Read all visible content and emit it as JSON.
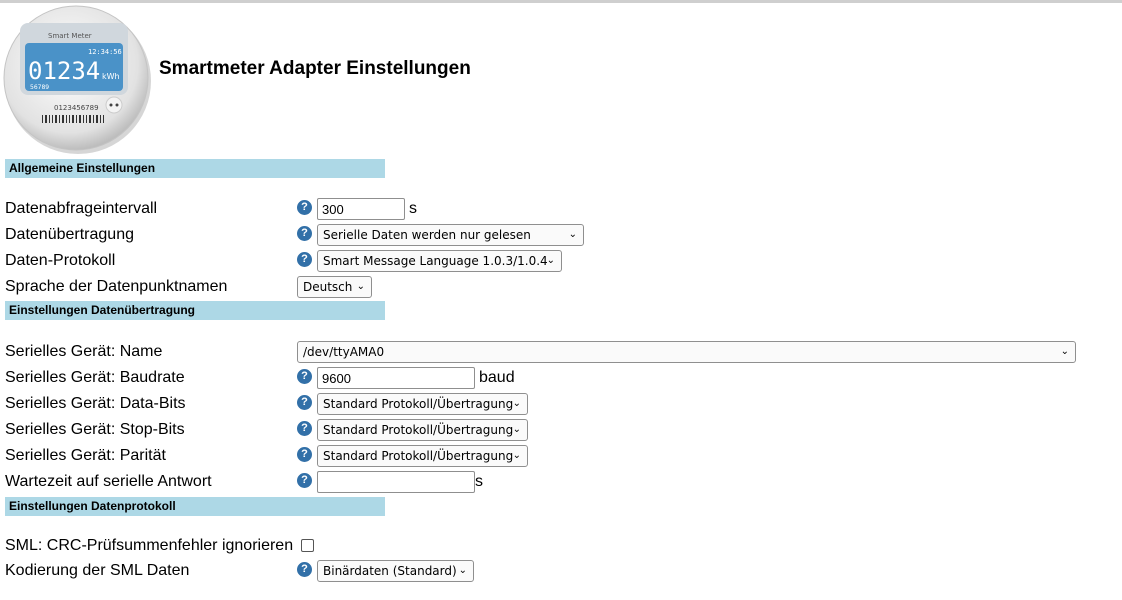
{
  "page": {
    "title": "Smartmeter Adapter Einstellungen"
  },
  "logo": {
    "brand": "Smart Meter",
    "time": "12:34:56",
    "reading": "01234",
    "unit": "kWh",
    "sub": "56789",
    "serial": "0123456789"
  },
  "sections": {
    "general": "Allgemeine Einstellungen",
    "transfer": "Einstellungen Datenübertragung",
    "protocol": "Einstellungen Datenprotokoll"
  },
  "general": {
    "interval": {
      "label": "Datenabfrageintervall",
      "value": "300",
      "unit": "s"
    },
    "transfer_mode": {
      "label": "Datenübertragung",
      "value": "Serielle Daten werden nur gelesen"
    },
    "protocol": {
      "label": "Daten-Protokoll",
      "value": "Smart Message Language 1.0.3/1.0.4"
    },
    "language": {
      "label": "Sprache der Datenpunktnamen",
      "value": "Deutsch"
    }
  },
  "serial": {
    "name": {
      "label": "Serielles Gerät: Name",
      "value": "/dev/ttyAMA0"
    },
    "baud": {
      "label": "Serielles Gerät: Baudrate",
      "value": "9600",
      "unit": "baud"
    },
    "databits": {
      "label": "Serielles Gerät: Data-Bits",
      "value": "Standard Protokoll/Übertragung"
    },
    "stopbits": {
      "label": "Serielles Gerät: Stop-Bits",
      "value": "Standard Protokoll/Übertragung"
    },
    "parity": {
      "label": "Serielles Gerät: Parität",
      "value": "Standard Protokoll/Übertragung"
    },
    "timeout": {
      "label": "Wartezeit auf serielle Antwort",
      "value": "",
      "unit": "s"
    }
  },
  "protocol": {
    "crc": {
      "label": "SML: CRC-Prüfsummenfehler ignorieren",
      "checked": false
    },
    "encoding": {
      "label": "Kodierung der SML Daten",
      "value": "Binärdaten (Standard)"
    }
  },
  "icons": {
    "help": "help-icon",
    "dropdown": "chevron-down-icon",
    "logo": "smart-meter-logo"
  },
  "colors": {
    "section_bg": "#add8e6",
    "help_icon": "#3270a8"
  }
}
